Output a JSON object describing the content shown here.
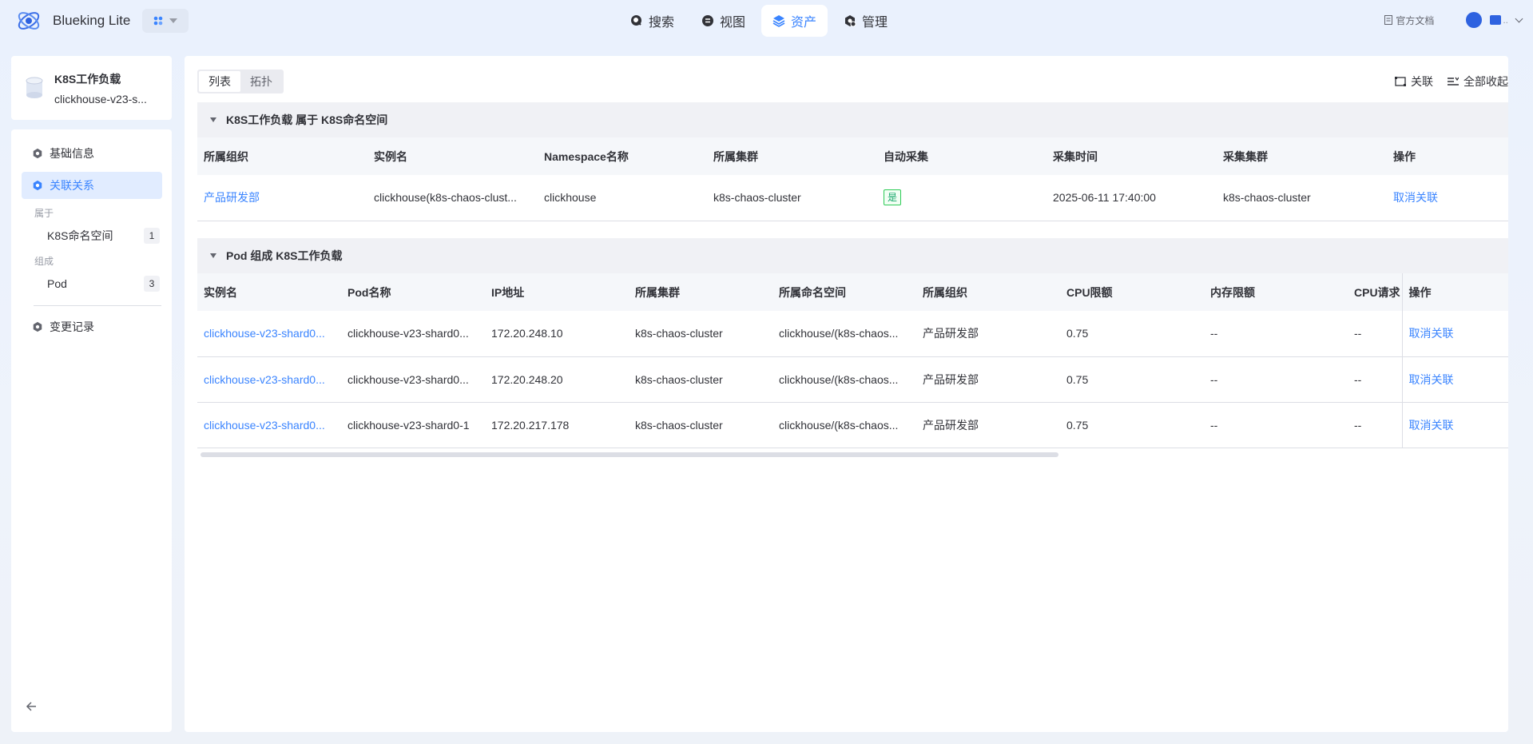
{
  "brand": {
    "name": "Blueking Lite"
  },
  "nav": [
    {
      "label": "搜索",
      "icon": "search-icon",
      "active": false
    },
    {
      "label": "视图",
      "icon": "view-icon",
      "active": false
    },
    {
      "label": "资产",
      "icon": "layers-icon",
      "active": true
    },
    {
      "label": "管理",
      "icon": "gear-icon",
      "active": false
    }
  ],
  "header": {
    "doc_label": "官方文档"
  },
  "object": {
    "title": "K8S工作负载",
    "subtitle": "clickhouse-v23-s..."
  },
  "sidebar": {
    "basic_info": "基础信息",
    "relations": "关联关系",
    "belongs_group": "属于",
    "namespace_item": {
      "label": "K8S命名空间",
      "count": "1"
    },
    "compose_group": "组成",
    "pod_item": {
      "label": "Pod",
      "count": "3"
    },
    "change_log": "变更记录"
  },
  "tabs": {
    "list": "列表",
    "topology": "拓扑"
  },
  "actions": {
    "relate": "关联",
    "collapse_all": "全部收起"
  },
  "section1": {
    "title": "K8S工作负载 属于 K8S命名空间",
    "columns": [
      "所属组织",
      "实例名",
      "Namespace名称",
      "所属集群",
      "自动采集",
      "采集时间",
      "采集集群",
      "操作"
    ],
    "rows": [
      {
        "org": "产品研发部",
        "instance": "clickhouse(k8s-chaos-clust...",
        "namespace": "clickhouse",
        "cluster": "k8s-chaos-cluster",
        "auto": "是",
        "time": "2025-06-11 17:40:00",
        "collect_cluster": "k8s-chaos-cluster",
        "op": "取消关联"
      }
    ]
  },
  "section2": {
    "title": "Pod 组成 K8S工作负载",
    "columns": [
      "实例名",
      "Pod名称",
      "IP地址",
      "所属集群",
      "所属命名空间",
      "所属组织",
      "CPU限额",
      "内存限额",
      "CPU请求",
      "操作"
    ],
    "rows": [
      {
        "instance": "clickhouse-v23-shard0...",
        "pod": "clickhouse-v23-shard0...",
        "ip": "172.20.248.10",
        "cluster": "k8s-chaos-cluster",
        "ns": "clickhouse/(k8s-chaos...",
        "org": "产品研发部",
        "cpu_limit": "0.75",
        "mem_limit": "--",
        "cpu_req": "--",
        "op": "取消关联"
      },
      {
        "instance": "clickhouse-v23-shard0...",
        "pod": "clickhouse-v23-shard0...",
        "ip": "172.20.248.20",
        "cluster": "k8s-chaos-cluster",
        "ns": "clickhouse/(k8s-chaos...",
        "org": "产品研发部",
        "cpu_limit": "0.75",
        "mem_limit": "--",
        "cpu_req": "--",
        "op": "取消关联"
      },
      {
        "instance": "clickhouse-v23-shard0...",
        "pod": "clickhouse-v23-shard0-1",
        "ip": "172.20.217.178",
        "cluster": "k8s-chaos-cluster",
        "ns": "clickhouse/(k8s-chaos...",
        "org": "产品研发部",
        "cpu_limit": "0.75",
        "mem_limit": "--",
        "cpu_req": "--",
        "op": "取消关联"
      }
    ]
  },
  "colors": {
    "accent": "#3a84ff",
    "active_bg": "#e1ecff",
    "success": "#2dcb56"
  }
}
